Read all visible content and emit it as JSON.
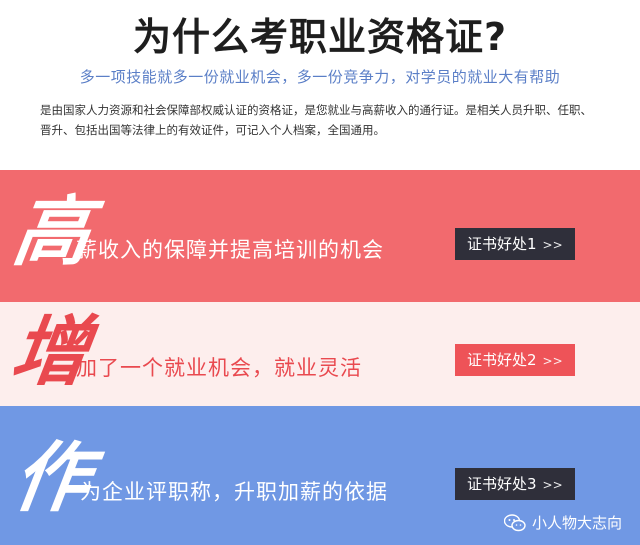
{
  "header": {
    "title": "为什么考职业资格证?",
    "subtitle": "多一项技能就多一份就业机会，多一份竞争力，对学员的就业大有帮助",
    "description": "是由国家人力资源和社会保障部权威认证的资格证，是您就业与高薪收入的通行证。是相关人员升职、任职、晋升、包括出国等法律上的有效证件，可记入个人档案，全国通用。"
  },
  "bands": [
    {
      "char": "高",
      "text": "薪收入的保障并提高培训的机会",
      "badge": "证书好处1",
      "arrow": ">>"
    },
    {
      "char": "增",
      "text": "加了一个就业机会，就业灵活",
      "badge": "证书好处2",
      "arrow": ">>"
    },
    {
      "char": "作",
      "text": "为企业评职称，升职加薪的依据",
      "badge": "证书好处3",
      "arrow": ">>"
    }
  ],
  "watermark": {
    "text": "小人物大志向",
    "icon": "wechat-icon"
  },
  "colors": {
    "band1_bg": "#f26a6e",
    "band2_bg": "#fdeeed",
    "band3_bg": "#7098e4",
    "subtitle": "#5b7fc7",
    "dark_badge": "#2f2f3a",
    "red_badge": "#ee5358"
  }
}
